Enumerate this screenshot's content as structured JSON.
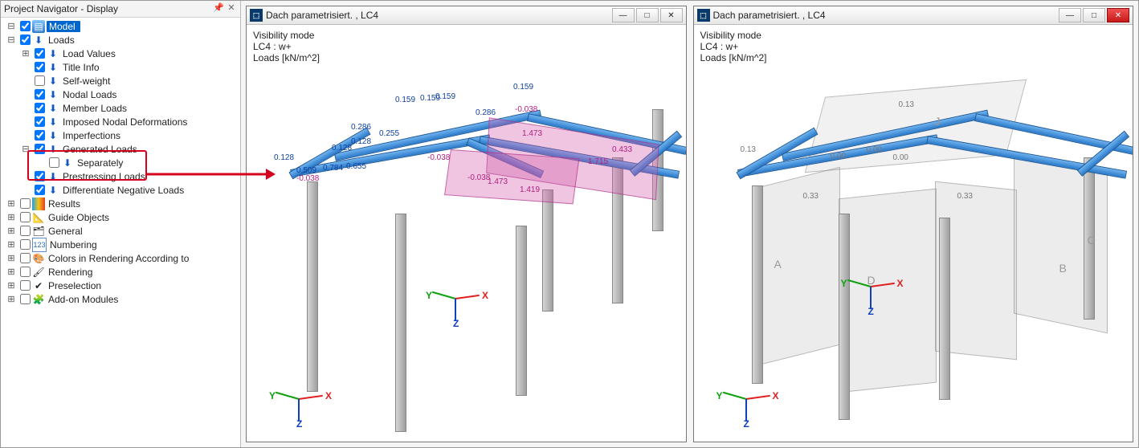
{
  "navigator": {
    "title": "Project Navigator - Display",
    "items": [
      {
        "id": "model",
        "label": "Model",
        "depth": 0,
        "toggle": "-",
        "checked": true,
        "icon": "model",
        "selected": true
      },
      {
        "id": "loads",
        "label": "Loads",
        "depth": 0,
        "toggle": "-",
        "checked": true,
        "icon": "load"
      },
      {
        "id": "loadvalues",
        "label": "Load Values",
        "depth": 1,
        "toggle": "+",
        "checked": true,
        "icon": "load"
      },
      {
        "id": "titleinfo",
        "label": "Title Info",
        "depth": 1,
        "toggle": "",
        "checked": true,
        "icon": "load"
      },
      {
        "id": "selfweight",
        "label": "Self-weight",
        "depth": 1,
        "toggle": "",
        "checked": false,
        "icon": "load"
      },
      {
        "id": "nodalloads",
        "label": "Nodal Loads",
        "depth": 1,
        "toggle": "",
        "checked": true,
        "icon": "load"
      },
      {
        "id": "memberloads",
        "label": "Member Loads",
        "depth": 1,
        "toggle": "",
        "checked": true,
        "icon": "load"
      },
      {
        "id": "imposed",
        "label": "Imposed Nodal Deformations",
        "depth": 1,
        "toggle": "",
        "checked": true,
        "icon": "load"
      },
      {
        "id": "imperf",
        "label": "Imperfections",
        "depth": 1,
        "toggle": "",
        "checked": true,
        "icon": "load"
      },
      {
        "id": "genloads",
        "label": "Generated Loads",
        "depth": 1,
        "toggle": "-",
        "checked": true,
        "icon": "load"
      },
      {
        "id": "separately",
        "label": "Separately",
        "depth": 2,
        "toggle": "",
        "checked": false,
        "icon": "load"
      },
      {
        "id": "prestress",
        "label": "Prestressing Loads",
        "depth": 1,
        "toggle": "",
        "checked": true,
        "icon": "load"
      },
      {
        "id": "diffneg",
        "label": "Differentiate Negative Loads",
        "depth": 1,
        "toggle": "",
        "checked": true,
        "icon": "load"
      },
      {
        "id": "results",
        "label": "Results",
        "depth": 0,
        "toggle": "+",
        "checked": false,
        "icon": "results"
      },
      {
        "id": "guide",
        "label": "Guide Objects",
        "depth": 0,
        "toggle": "+",
        "checked": false,
        "icon": "guide"
      },
      {
        "id": "general",
        "label": "General",
        "depth": 0,
        "toggle": "+",
        "checked": false,
        "icon": "general"
      },
      {
        "id": "numbering",
        "label": "Numbering",
        "depth": 0,
        "toggle": "+",
        "checked": false,
        "icon": "numbering"
      },
      {
        "id": "colors",
        "label": "Colors in Rendering According to",
        "depth": 0,
        "toggle": "+",
        "checked": false,
        "icon": "colors"
      },
      {
        "id": "rendering",
        "label": "Rendering",
        "depth": 0,
        "toggle": "+",
        "checked": false,
        "icon": "render"
      },
      {
        "id": "presel",
        "label": "Preselection",
        "depth": 0,
        "toggle": "+",
        "checked": false,
        "icon": "presel"
      },
      {
        "id": "addon",
        "label": "Add-on Modules",
        "depth": 0,
        "toggle": "+",
        "checked": false,
        "icon": "addon"
      }
    ]
  },
  "win1": {
    "title": "Dach parametrisiert. , LC4",
    "info": [
      "Visibility mode",
      "LC4 : w+",
      "Loads [kN/m^2]"
    ],
    "axes": {
      "x": "X",
      "y": "Y",
      "z": "Z"
    },
    "values": {
      "v0159a": "0.159",
      "v0159b": "0.159",
      "v0159c": "0.159",
      "v0159d": "0.159",
      "v0286a": "0.286",
      "v0286b": "0.286",
      "v0128a": "0.128",
      "v0128b": "0.128",
      "v0128c": "0.128",
      "v0255": "0.255",
      "v0038a": "-0.038",
      "v0038b": "-0.038",
      "v0038c": "-0.038",
      "v0038d": "-0.038",
      "v1473a": "1.473",
      "v1473b": "1.473",
      "v0433": "0.433",
      "v1419": "1.419",
      "v1715": "1.715",
      "v0509": "0.509",
      "v0784": "0.784",
      "v0655": "0.655"
    }
  },
  "win2": {
    "title": "Dach parametrisiert. , LC4",
    "info": [
      "Visibility mode",
      "LC4 : w+",
      "Loads [kN/m^2]"
    ],
    "axes": {
      "x": "X",
      "y": "Y",
      "z": "Z"
    },
    "values": {
      "v013a": "0.13",
      "v013b": "0.13",
      "v000a": "0.00",
      "v000b": "0.00",
      "v000c": "0.00",
      "v033a": "0.33",
      "v033b": "0.33"
    },
    "axis_letters": {
      "a": "A",
      "b": "B",
      "c": "C",
      "d": "D",
      "j": "J"
    }
  }
}
